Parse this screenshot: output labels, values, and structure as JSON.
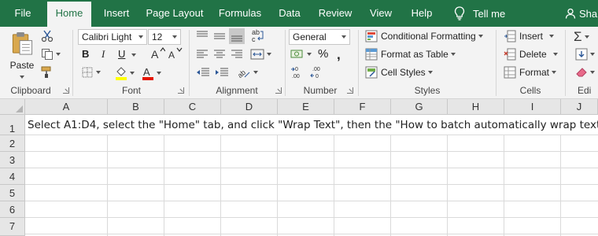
{
  "tabs": [
    {
      "label": "File"
    },
    {
      "label": "Home"
    },
    {
      "label": "Insert"
    },
    {
      "label": "Page Layout"
    },
    {
      "label": "Formulas"
    },
    {
      "label": "Data"
    },
    {
      "label": "Review"
    },
    {
      "label": "View"
    },
    {
      "label": "Help"
    }
  ],
  "tell_me": "Tell me",
  "share": "Shar",
  "ribbon": {
    "clipboard": {
      "label": "Clipboard",
      "paste": "Paste"
    },
    "font": {
      "label": "Font",
      "name": "Calibri Light",
      "size": "12",
      "bold": "B",
      "italic": "I",
      "underline": "U"
    },
    "alignment": {
      "label": "Alignment"
    },
    "number": {
      "label": "Number",
      "format": "General"
    },
    "styles": {
      "label": "Styles",
      "conditional": "Conditional Formatting",
      "format_table": "Format as Table",
      "cell_styles": "Cell Styles"
    },
    "cells": {
      "label": "Cells",
      "insert": "Insert",
      "delete": "Delete",
      "format": "Format"
    },
    "editing": {
      "label": "Edi"
    }
  },
  "colors": {
    "accent": "#217346",
    "font_highlight": "#ffff00",
    "font_color": "#e51400"
  },
  "grid": {
    "columns": [
      "A",
      "B",
      "C",
      "D",
      "E",
      "F",
      "G",
      "H",
      "I",
      "J"
    ],
    "rows": [
      "1",
      "2",
      "3",
      "4",
      "5",
      "6",
      "7"
    ],
    "a1_text": "Select A1:D4, select the \"Home\" tab, and click \"Wrap Text\", then the \"How to batch automatically wrap text in e"
  }
}
